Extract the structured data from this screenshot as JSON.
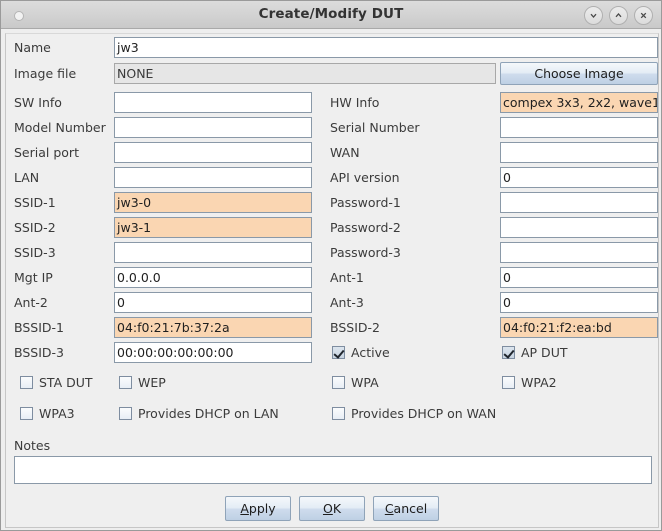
{
  "window": {
    "title": "Create/Modify DUT",
    "controls": [
      {
        "name": "minimize-button",
        "icon": "chevron-down-icon"
      },
      {
        "name": "maximize-button",
        "icon": "chevron-up-icon"
      },
      {
        "name": "close-button",
        "icon": "close-icon"
      }
    ]
  },
  "colors": {
    "highlight_field": "#fad6b2",
    "titlebar": "#d6d6d6",
    "panel": "#efefef",
    "field_border": "#8a99a8"
  },
  "form": {
    "name": {
      "label": "Name",
      "value": "jw3"
    },
    "image_file": {
      "label": "Image file",
      "value": "NONE",
      "button": "Choose Image"
    },
    "sw_info": {
      "label": "SW Info",
      "value": ""
    },
    "hw_info": {
      "label": "HW Info",
      "value": "compex 3x3, 2x2, wave1"
    },
    "model_number": {
      "label": "Model Number",
      "value": ""
    },
    "serial_number": {
      "label": "Serial Number",
      "value": ""
    },
    "serial_port": {
      "label": "Serial port",
      "value": ""
    },
    "wan": {
      "label": "WAN",
      "value": ""
    },
    "lan": {
      "label": "LAN",
      "value": ""
    },
    "api_version": {
      "label": "API version",
      "value": "0"
    },
    "ssid_1": {
      "label": "SSID-1",
      "value": "jw3-0"
    },
    "password_1": {
      "label": "Password-1",
      "value": ""
    },
    "ssid_2": {
      "label": "SSID-2",
      "value": "jw3-1"
    },
    "password_2": {
      "label": "Password-2",
      "value": ""
    },
    "ssid_3": {
      "label": "SSID-3",
      "value": ""
    },
    "password_3": {
      "label": "Password-3",
      "value": ""
    },
    "mgt_ip": {
      "label": "Mgt IP",
      "value": "0.0.0.0"
    },
    "ant_1": {
      "label": "Ant-1",
      "value": "0"
    },
    "ant_2": {
      "label": "Ant-2",
      "value": "0"
    },
    "ant_3": {
      "label": "Ant-3",
      "value": "0"
    },
    "bssid_1": {
      "label": "BSSID-1",
      "value": "04:f0:21:7b:37:2a"
    },
    "bssid_2": {
      "label": "BSSID-2",
      "value": "04:f0:21:f2:ea:bd"
    },
    "bssid_3": {
      "label": "BSSID-3",
      "value": "00:00:00:00:00:00"
    },
    "notes": {
      "label": "Notes",
      "value": ""
    }
  },
  "checkboxes": {
    "active": {
      "label": "Active",
      "checked": true
    },
    "ap_dut": {
      "label": "AP DUT",
      "checked": true
    },
    "sta_dut": {
      "label": "STA DUT",
      "checked": false
    },
    "wep": {
      "label": "WEP",
      "checked": false
    },
    "wpa": {
      "label": "WPA",
      "checked": false
    },
    "wpa2": {
      "label": "WPA2",
      "checked": false
    },
    "wpa3": {
      "label": "WPA3",
      "checked": false
    },
    "dhcp_lan": {
      "label": "Provides DHCP on LAN",
      "checked": false
    },
    "dhcp_wan": {
      "label": "Provides DHCP on WAN",
      "checked": false
    }
  },
  "footer": {
    "apply": {
      "mnemonic": "A",
      "rest": "pply"
    },
    "ok": {
      "mnemonic": "O",
      "rest": "K"
    },
    "cancel": {
      "mnemonic": "C",
      "rest": "ancel"
    }
  }
}
